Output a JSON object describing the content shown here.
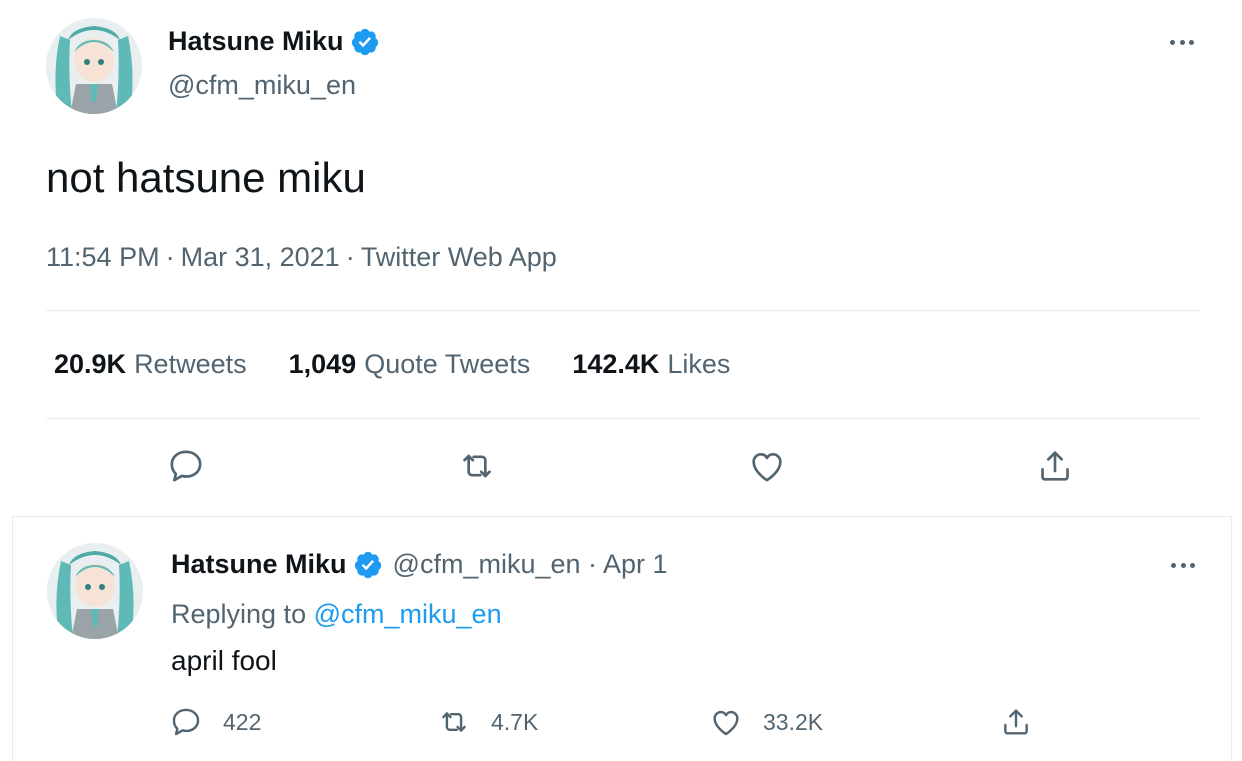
{
  "main_tweet": {
    "display_name": "Hatsune Miku",
    "handle": "@cfm_miku_en",
    "text": "not hatsune miku",
    "time": "11:54 PM",
    "date": "Mar 31, 2021",
    "source": "Twitter Web App",
    "stats": {
      "retweets_count": "20.9K",
      "retweets_label": "Retweets",
      "quotes_count": "1,049",
      "quotes_label": "Quote Tweets",
      "likes_count": "142.4K",
      "likes_label": "Likes"
    },
    "icons": [
      "reply-icon",
      "retweet-icon",
      "like-icon",
      "share-icon"
    ]
  },
  "reply": {
    "display_name": "Hatsune Miku",
    "handle_time": "@cfm_miku_en · Apr 1",
    "replying_prefix": "Replying to",
    "replying_mention": "@cfm_miku_en",
    "text": "april fool",
    "counts": {
      "replies": "422",
      "retweets": "4.7K",
      "likes": "33.2K"
    }
  },
  "colors": {
    "verified": "#1d9bf0",
    "link": "#1d9bf0",
    "secondary_text": "#536471",
    "primary_text": "#0f1419",
    "divider": "#e6ecf0"
  }
}
